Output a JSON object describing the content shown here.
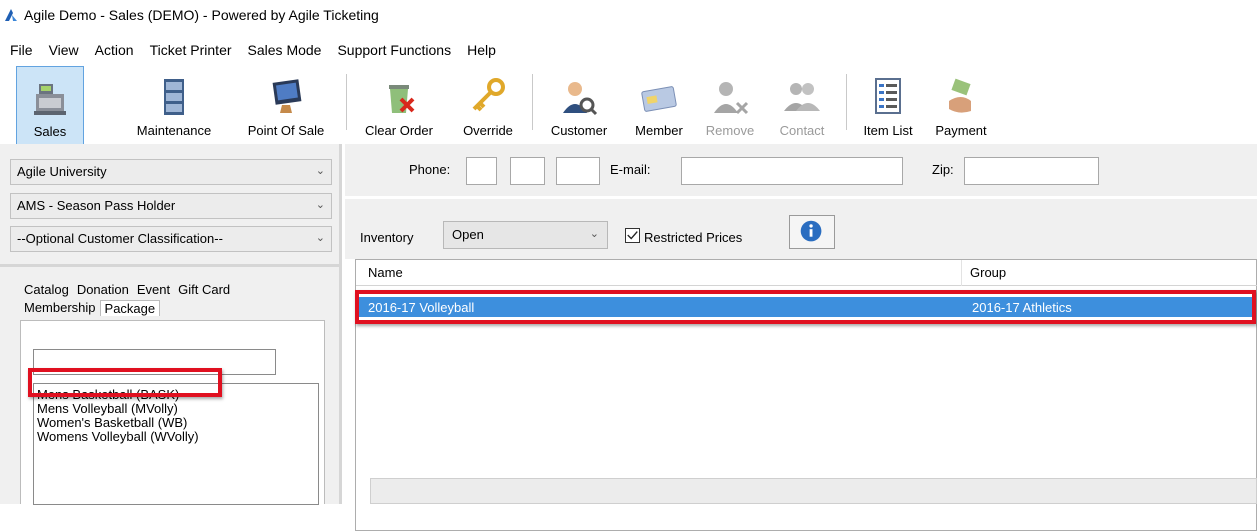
{
  "app": {
    "title": "Agile Demo - Sales (DEMO) - Powered by Agile Ticketing"
  },
  "menu": [
    "File",
    "View",
    "Action",
    "Ticket Printer",
    "Sales Mode",
    "Support Functions",
    "Help"
  ],
  "toolbar": {
    "sales": "Sales",
    "maintenance": "Maintenance",
    "point_of_sale": "Point Of Sale",
    "clear_order": "Clear Order",
    "override": "Override",
    "customer": "Customer",
    "member": "Member",
    "remove": "Remove",
    "contact": "Contact",
    "item_list": "Item List",
    "payment": "Payment"
  },
  "left": {
    "organization": "Agile University",
    "price_type": "AMS - Season Pass Holder",
    "classification": "--Optional Customer Classification--",
    "tabs_row1": [
      "Catalog",
      "Donation",
      "Event",
      "Gift Card"
    ],
    "tabs_row2": [
      "Membership",
      "Package"
    ],
    "search_value": "",
    "packages": [
      "Mens Basketball  (BASK)",
      "Mens Volleyball  (MVolly)",
      "Women's Basketball  (WB)",
      "Womens Volleyball  (WVolly)"
    ]
  },
  "customer_search": {
    "phone_label": "Phone:",
    "email_label": "E-mail:",
    "zip_label": "Zip:"
  },
  "inventory": {
    "label": "Inventory",
    "value": "Open",
    "restricted_label": "Restricted Prices",
    "restricted_checked": true
  },
  "grid": {
    "columns": [
      "Name",
      "Group"
    ],
    "rows": [
      {
        "name": "2016-17 Volleyball",
        "group": "2016-17 Athletics"
      }
    ]
  },
  "colors": {
    "highlight": "#e01020",
    "selection": "#3d8fdd",
    "accent": "#62a3e0"
  }
}
